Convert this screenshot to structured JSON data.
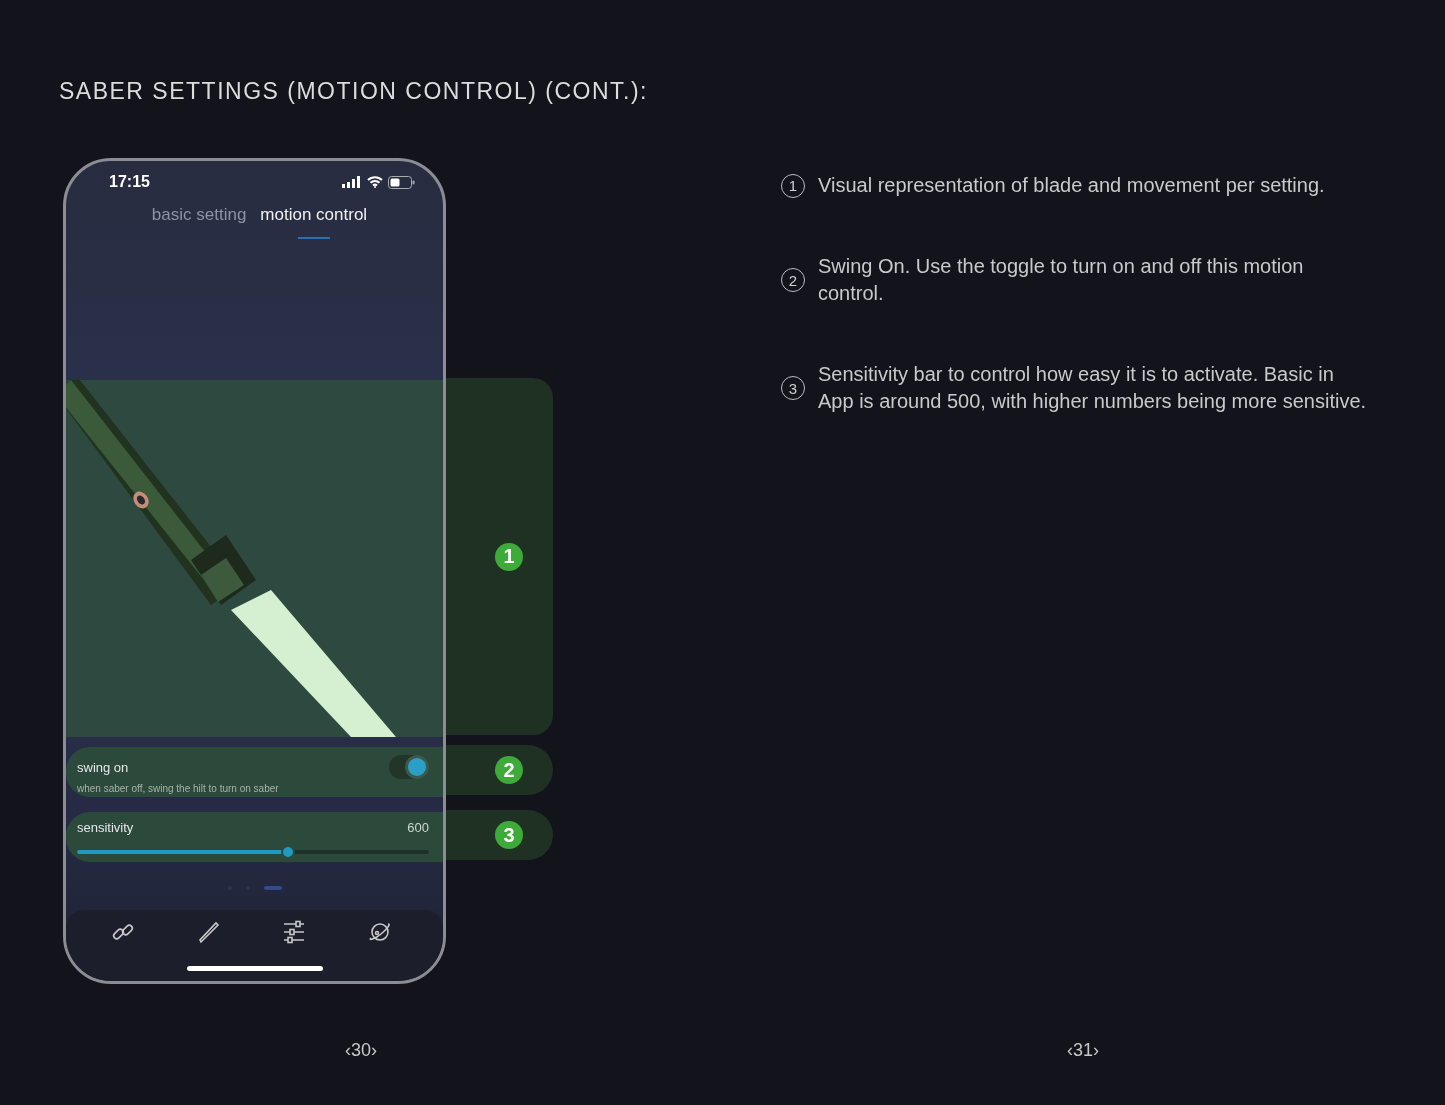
{
  "title": "SABER SETTINGS (MOTION CONTROL) (CONT.):",
  "phone": {
    "status_bar": {
      "time": "17:15"
    },
    "tabs": [
      {
        "label": "basic setting",
        "selected": false
      },
      {
        "label": "motion control",
        "selected": true
      }
    ],
    "preview": {
      "callout": "1"
    },
    "settings": [
      {
        "kind": "toggle",
        "label": "swing on",
        "description": "when saber off, swing the hilt to turn on saber",
        "on": true,
        "callout": "2"
      },
      {
        "kind": "slider",
        "label": "sensitivity",
        "reading": "600",
        "level": 0.6,
        "callout": "3"
      }
    ],
    "pager": [
      {
        "selected": false
      },
      {
        "selected": false
      },
      {
        "selected": true
      }
    ]
  },
  "notes": [
    {
      "number": "1",
      "text": "Visual representation of blade and movement per setting."
    },
    {
      "number": "2",
      "text": "Swing On. Use the toggle to turn on and off this motion control."
    },
    {
      "number": "3",
      "text": "Sensitivity bar to control how easy it is to activate. Basic in App is around 500, with higher numbers being more sensitive."
    }
  ],
  "page_numbers": [
    "‹30›",
    "‹31›"
  ]
}
